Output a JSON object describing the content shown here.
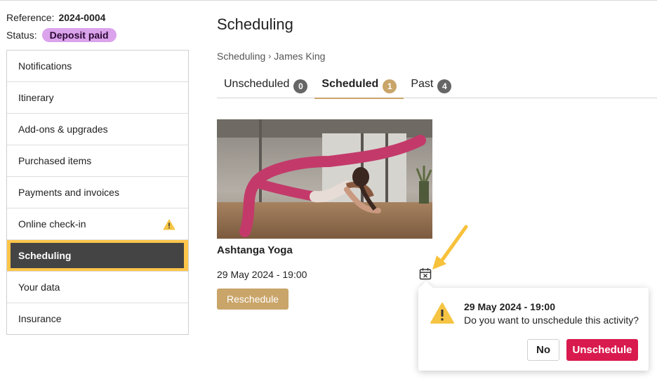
{
  "meta": {
    "reference_label": "Reference:",
    "reference_value": "2024-0004",
    "status_label": "Status:",
    "status_value": "Deposit paid",
    "status_color": "#dba3ec"
  },
  "sidebar": {
    "items": [
      {
        "label": "Notifications"
      },
      {
        "label": "Itinerary"
      },
      {
        "label": "Add-ons & upgrades"
      },
      {
        "label": "Purchased items"
      },
      {
        "label": "Payments and invoices"
      },
      {
        "label": "Online check-in",
        "icon": "warning-icon"
      },
      {
        "label": "Scheduling",
        "active": true
      },
      {
        "label": "Your data"
      },
      {
        "label": "Insurance"
      }
    ],
    "active_color": "#ffc54a"
  },
  "main": {
    "title": "Scheduling",
    "breadcrumb": {
      "parent": "Scheduling",
      "separator": "›",
      "current": "James King"
    },
    "tabs": [
      {
        "label": "Unscheduled",
        "count": "0"
      },
      {
        "label": "Scheduled",
        "count": "1",
        "active": true
      },
      {
        "label": "Past",
        "count": "4"
      }
    ],
    "accent_color": "#c9a56a"
  },
  "activity": {
    "title": "Ashtanga Yoga",
    "datetime": "29 May 2024 - 19:00",
    "reschedule_label": "Reschedule",
    "image_icon": "yoga-photo",
    "unschedule_icon": "calendar-x-icon"
  },
  "popover": {
    "title": "29 May 2024 - 19:00",
    "message": "Do you want to unschedule this activity?",
    "no_label": "No",
    "confirm_label": "Unschedule",
    "confirm_color": "#d91a4e"
  }
}
